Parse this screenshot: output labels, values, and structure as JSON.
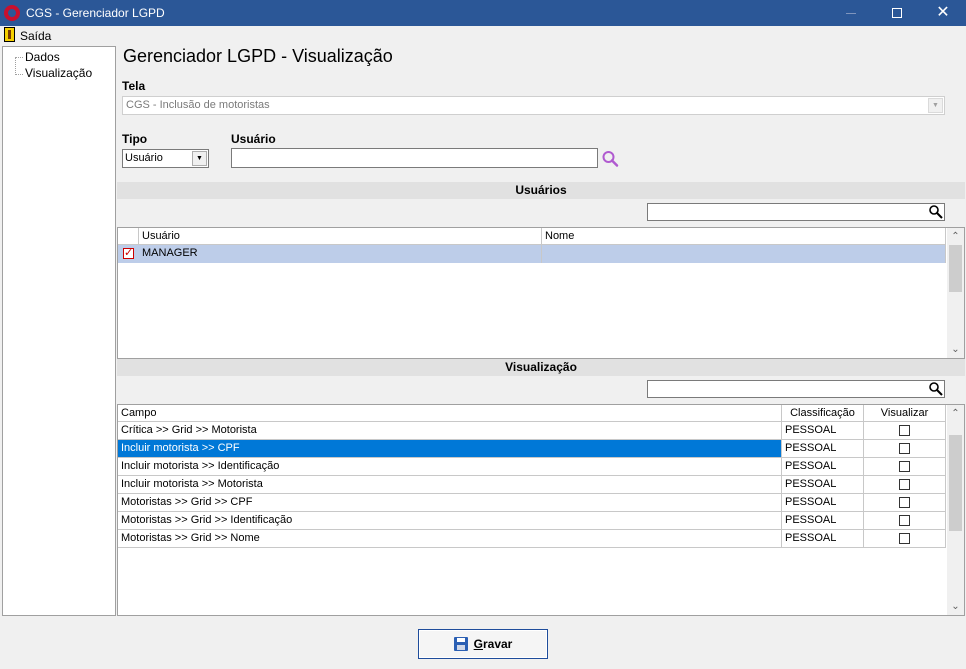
{
  "window": {
    "title": "CGS - Gerenciador LGPD"
  },
  "menu": {
    "exit_label": "Saída"
  },
  "tree": {
    "items": [
      {
        "label": "Dados"
      },
      {
        "label": "Visualização"
      }
    ]
  },
  "main": {
    "title": "Gerenciador LGPD - Visualização",
    "tela_label": "Tela",
    "tela_value": "CGS - Inclusão de motoristas",
    "tipo_label": "Tipo",
    "tipo_value": "Usuário",
    "usuario_label": "Usuário",
    "usuario_value": ""
  },
  "users_section": {
    "header": "Usuários",
    "filter_value": "",
    "columns": [
      "Usuário",
      "Nome"
    ],
    "rows": [
      {
        "usuario": "MANAGER",
        "nome": "",
        "checked": true
      }
    ]
  },
  "view_section": {
    "header": "Visualização",
    "filter_value": "",
    "columns": [
      "Campo",
      "Classificação",
      "Visualizar"
    ],
    "rows": [
      {
        "campo": "Crítica >> Grid >> Motorista",
        "classificacao": "PESSOAL",
        "visualizar": false
      },
      {
        "campo": "Incluir motorista >> CPF",
        "classificacao": "PESSOAL",
        "visualizar": false
      },
      {
        "campo": "Incluir motorista >> Identificação",
        "classificacao": "PESSOAL",
        "visualizar": false
      },
      {
        "campo": "Incluir motorista >> Motorista",
        "classificacao": "PESSOAL",
        "visualizar": false
      },
      {
        "campo": "Motoristas >> Grid >> CPF",
        "classificacao": "PESSOAL",
        "visualizar": false
      },
      {
        "campo": "Motoristas >> Grid >> Identificação",
        "classificacao": "PESSOAL",
        "visualizar": false
      },
      {
        "campo": "Motoristas >> Grid >> Nome",
        "classificacao": "PESSOAL",
        "visualizar": false
      }
    ]
  },
  "footer": {
    "save_label": "Gravar"
  },
  "colors": {
    "titlebar": "#2b5797",
    "selection": "#0078d7",
    "user_row": "#bdcde9",
    "search_icon_purple": "#b05ad0"
  }
}
